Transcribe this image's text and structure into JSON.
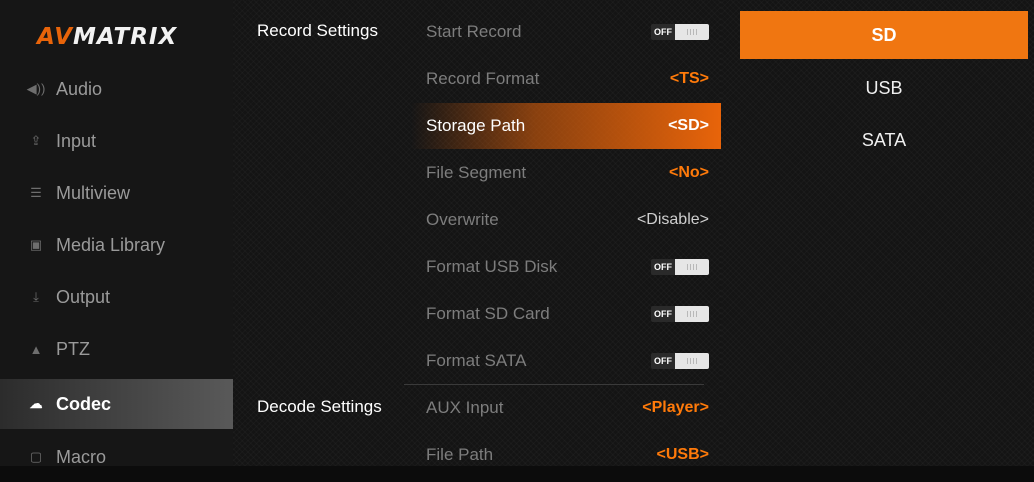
{
  "logo": {
    "part1": "AV",
    "part2": "MATRIX"
  },
  "sidebar": {
    "items": [
      {
        "label": "Audio",
        "icon": "speaker-icon"
      },
      {
        "label": "Input",
        "icon": "upload-icon"
      },
      {
        "label": "Multiview",
        "icon": "list-icon"
      },
      {
        "label": "Media Library",
        "icon": "image-icon"
      },
      {
        "label": "Output",
        "icon": "download-icon"
      },
      {
        "label": "PTZ",
        "icon": "camera-icon"
      },
      {
        "label": "Codec",
        "icon": "cloud-icon",
        "active": true
      },
      {
        "label": "Macro",
        "icon": "macro-icon"
      }
    ]
  },
  "record": {
    "title": "Record Settings",
    "rows": [
      {
        "label": "Start Record",
        "toggle": "OFF"
      },
      {
        "label": "Record Format",
        "value": "<TS>"
      },
      {
        "label": "Storage Path",
        "value": "<SD>",
        "selected": true
      },
      {
        "label": "File Segment",
        "value": "<No>"
      },
      {
        "label": "Overwrite",
        "value": "<Disable>"
      },
      {
        "label": "Format USB Disk",
        "toggle": "OFF"
      },
      {
        "label": "Format SD Card",
        "toggle": "OFF"
      },
      {
        "label": "Format SATA",
        "toggle": "OFF"
      }
    ]
  },
  "decode": {
    "title": "Decode Settings",
    "rows": [
      {
        "label": "AUX Input",
        "value": "<Player>"
      },
      {
        "label": "File Path",
        "value": "<USB>"
      }
    ]
  },
  "options": [
    {
      "label": "SD",
      "selected": true
    },
    {
      "label": "USB"
    },
    {
      "label": "SATA"
    }
  ],
  "colors": {
    "accent": "#e8640a",
    "value_orange": "#ff7a0a",
    "selected_option": "#f07611"
  }
}
